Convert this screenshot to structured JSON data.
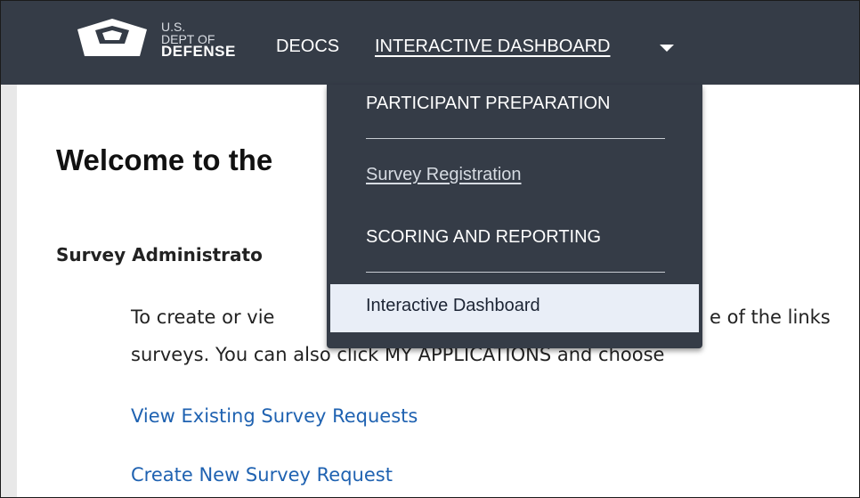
{
  "header": {
    "logo": {
      "line1": "U.S.",
      "line2": "DEPT OF",
      "line3": "DEFENSE"
    },
    "nav": [
      {
        "label": "DEOCS"
      },
      {
        "label": "INTERACTIVE DASHBOARD"
      }
    ]
  },
  "dropdown": {
    "section1": "PARTICIPANT PREPARATION",
    "registration_link": "Survey Registration",
    "section2": "SCORING AND REPORTING",
    "active_item": "Interactive Dashboard"
  },
  "main": {
    "welcome": "Welcome to the",
    "subheading": "Survey Administrato",
    "para1_left": "To create or vie",
    "para1_right": "e of the links",
    "para2": "surveys.  You can also click MY APPLICATIONS and choose",
    "link1": "View Existing Survey Requests",
    "link2": "Create New Survey Request"
  },
  "colors": {
    "navbar": "#353c47",
    "link": "#1f62b1",
    "active_bg": "#e9eef7"
  },
  "icons": [
    "pentagon-logo-icon",
    "caret-down-icon"
  ]
}
